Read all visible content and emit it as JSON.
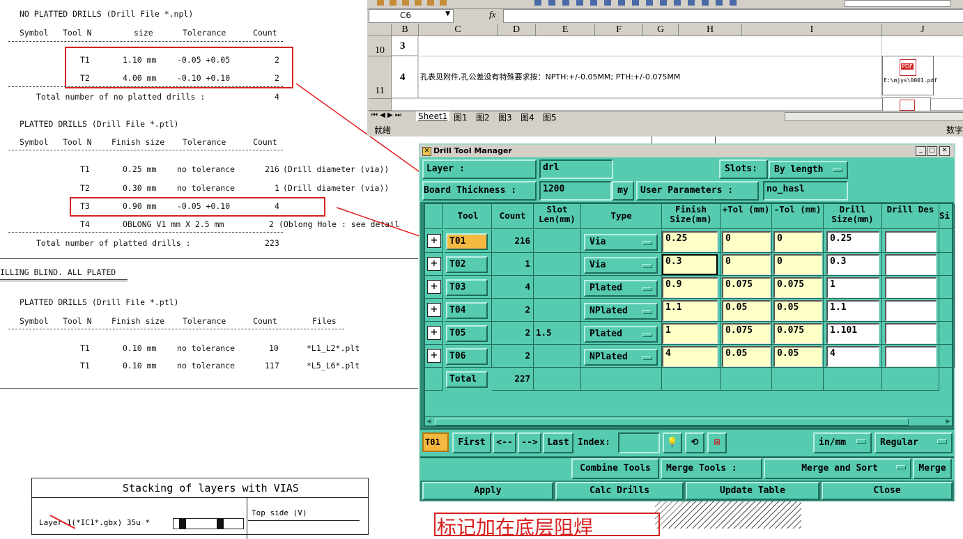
{
  "report": {
    "npl_title": "NO PLATTED DRILLS (Drill File *.npl)",
    "headers": [
      "Symbol",
      "Tool N",
      "size",
      "Tolerance",
      "Count"
    ],
    "npl_rows": [
      {
        "tool": "T1",
        "size": "1.10 mm",
        "tol": "-0.05 +0.05",
        "count": "2"
      },
      {
        "tool": "T2",
        "size": "4.00 mm",
        "tol": "-0.10 +0.10",
        "count": "2"
      }
    ],
    "npl_total_label": "Total number of no platted drills :",
    "npl_total": "4",
    "ptl_title": "PLATTED DRILLS (Drill File *.ptl)",
    "ptl_headers": [
      "Symbol",
      "Tool N",
      "Finish size",
      "Tolerance",
      "Count"
    ],
    "ptl_rows": [
      {
        "tool": "T1",
        "size": "0.25 mm",
        "tol": "no tolerance",
        "count": "216",
        "note": "(Drill diameter (via))"
      },
      {
        "tool": "T2",
        "size": "0.30 mm",
        "tol": "no tolerance",
        "count": "1",
        "note": "(Drill diameter (via))"
      },
      {
        "tool": "T3",
        "size": "0.90 mm",
        "tol": "-0.05 +0.10",
        "count": "4",
        "note": ""
      },
      {
        "tool": "T4",
        "size": "OBLONG V1 mm X 2.5 mm",
        "tol": "",
        "count": "2",
        "note": "(Oblong Hole : see detail"
      }
    ],
    "ptl_total_label": "Total number of platted drills :",
    "ptl_total": "223",
    "blind_title": "ILLING BLIND. ALL PLATED",
    "blind_sub": "PLATTED DRILLS (Drill File *.ptl)",
    "blind_headers": [
      "Symbol",
      "Tool N",
      "Finish size",
      "Tolerance",
      "Count",
      "Files"
    ],
    "blind_rows": [
      {
        "tool": "T1",
        "size": "0.10 mm",
        "tol": "no tolerance",
        "count": "10",
        "file": "*L1_L2*.plt"
      },
      {
        "tool": "T1",
        "size": "0.10 mm",
        "tol": "no tolerance",
        "count": "117",
        "file": "*L5_L6*.plt"
      }
    ],
    "stack_title": "Stacking of layers with VIAS",
    "stack_top": "Top side (V)",
    "stack_layer": "Layer 1(*IC1*.gbx) 35u *",
    "annotation": "标记加在底层阻焊"
  },
  "sheet": {
    "cell_ref": "C6",
    "fx": "fx",
    "columns": [
      "B",
      "C",
      "D",
      "E",
      "F",
      "G",
      "H",
      "I",
      "J"
    ],
    "row10_num": "10",
    "row10_b": "3",
    "row11_num": "11",
    "row11_b": "4",
    "row11_text": "孔表见附件,孔公差没有特殊要求按：NPTH:+/-0.05MM; PTH:+/-0.075MM",
    "pdf_caption": "E:\\mjys\\0001.pdf",
    "pdf_badge": "PDF",
    "tabs": [
      "Sheet1",
      "图1",
      "图2",
      "图3",
      "图4",
      "图5"
    ],
    "status": "就绪",
    "status_right": "数字"
  },
  "dialog": {
    "title": "Drill Tool Manager",
    "layer_label": "Layer       :",
    "layer_value": "drl",
    "slots_label": "Slots:",
    "slots_value": "By length",
    "board_label": "Board Thickness :",
    "board_value": "1200",
    "board_unit": "my",
    "userparam_label": "User Parameters :",
    "userparam_value": "no_hasl",
    "headers": {
      "tool": "Tool",
      "count": "Count",
      "slot": "Slot Len(mm)",
      "type": "Type",
      "finish": "Finish Size(mm)",
      "ptol": "+Tol (mm)",
      "mtol": "-Tol (mm)",
      "drill": "Drill Size(mm)",
      "des": "Drill Des",
      "si": "Si"
    },
    "rows": [
      {
        "tool": "T01",
        "count": "216",
        "slot": "",
        "type": "Via",
        "finish": "0.25",
        "ptol": "0",
        "mtol": "0",
        "drill": "0.25",
        "des": ""
      },
      {
        "tool": "T02",
        "count": "1",
        "slot": "",
        "type": "Via",
        "finish": "0.3",
        "ptol": "0",
        "mtol": "0",
        "drill": "0.3",
        "des": ""
      },
      {
        "tool": "T03",
        "count": "4",
        "slot": "",
        "type": "Plated",
        "finish": "0.9",
        "ptol": "0.075",
        "mtol": "0.075",
        "drill": "1",
        "des": ""
      },
      {
        "tool": "T04",
        "count": "2",
        "slot": "",
        "type": "NPlated",
        "finish": "1.1",
        "ptol": "0.05",
        "mtol": "0.05",
        "drill": "1.1",
        "des": ""
      },
      {
        "tool": "T05",
        "count": "2",
        "slot": "1.5",
        "type": "Plated",
        "finish": "1",
        "ptol": "0.075",
        "mtol": "0.075",
        "drill": "1.101",
        "des": ""
      },
      {
        "tool": "T06",
        "count": "2",
        "slot": "",
        "type": "NPlated",
        "finish": "4",
        "ptol": "0.05",
        "mtol": "0.05",
        "drill": "4",
        "des": ""
      }
    ],
    "total_label": "Total",
    "total_count": "227",
    "current_tool": "T01",
    "nav": {
      "first": "First",
      "prev": "<--",
      "next": "-->",
      "last": "Last",
      "index": "Index:"
    },
    "units_value": "in/mm",
    "mode_value": "Regular",
    "combine": "Combine Tools",
    "merge_label": "Merge Tools :",
    "merge_value": "Merge and Sort",
    "merge_btn": "Merge",
    "apply": "Apply",
    "calc": "Calc Drills",
    "update": "Update Table",
    "close": "Close"
  },
  "colors": {
    "dialog_bg": "#56cbb0",
    "dialog_dark": "#2f8a76",
    "input_yellow": "#ffffc8",
    "highlight_tool": "#f5b840",
    "red_annot": "#d81f1f"
  }
}
